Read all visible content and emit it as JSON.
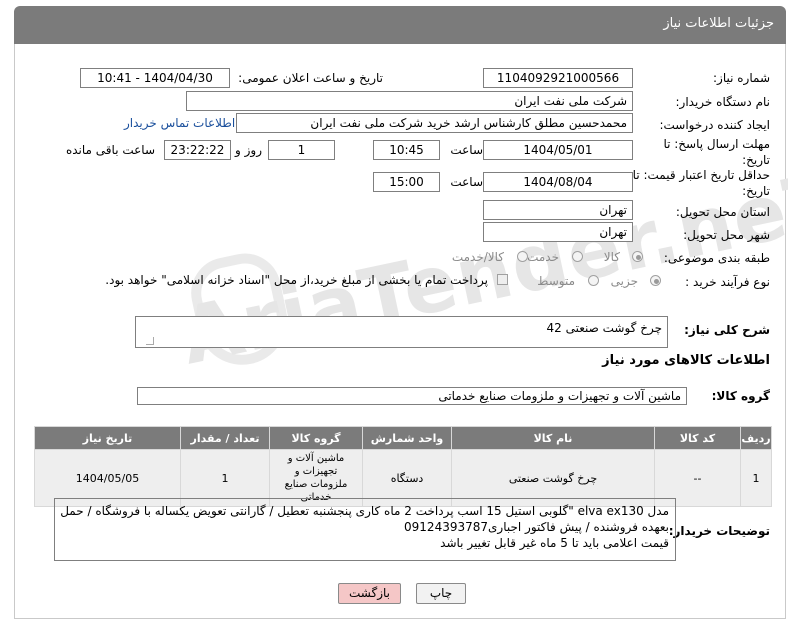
{
  "header": {
    "title": "جزئیات اطلاعات نیاز"
  },
  "fields": {
    "need_number_label": "شماره نیاز:",
    "need_number": "1104092921000566",
    "announce_label": "تاریخ و ساعت اعلان عمومی:",
    "announce_value": "1404/04/30 - 10:41",
    "buyer_org_label": "نام دستگاه خریدار:",
    "buyer_org": "شرکت ملی نفت ایران",
    "creator_label": "ایجاد کننده درخواست:",
    "creator": "محمدحسین مطلق کارشناس ارشد خرید شرکت ملی نفت ایران",
    "contact_link": "اطلاعات تماس خریدار",
    "deadline_label": "مهلت ارسال پاسخ: تا تاریخ:",
    "deadline_date": "1404/05/01",
    "time_label": "ساعت",
    "deadline_time": "10:45",
    "days_count": "1",
    "days_label": "روز و",
    "remaining_time": "23:22:22",
    "remaining_label": "ساعت باقی مانده",
    "price_validity_label": "حداقل تاریخ اعتبار قیمت: تا تاریخ:",
    "price_validity_date": "1404/08/04",
    "price_validity_time": "15:00",
    "province_label": "استان محل تحویل:",
    "province": "تهران",
    "city_label": "شهر محل تحویل:",
    "city": "تهران",
    "category_label": "طبقه بندی موضوعی:",
    "category_options": [
      "کالا",
      "خدمت",
      "کالا/خدمت"
    ],
    "process_label": "نوع فرآیند خرید :",
    "process_options": [
      "جزیی",
      "متوسط"
    ],
    "payment_note": "پرداخت تمام یا بخشی از مبلغ خرید،از محل \"اسناد خزانه اسلامی\" خواهد بود."
  },
  "summary": {
    "label": "شرح کلی نیاز:",
    "value": "چرخ گوشت صنعتی  42"
  },
  "goods_section": {
    "title": "اطلاعات کالاهای مورد نیاز",
    "group_label": "گروه کالا:",
    "group_value": "ماشین آلات و تجهیزات و ملزومات صنایع خدماتی"
  },
  "table": {
    "headers": [
      "ردیف",
      "کد کالا",
      "نام کالا",
      "واحد شمارش",
      "گروه کالا",
      "تعداد / مقدار",
      "تاریخ نیاز"
    ],
    "rows": [
      [
        "1",
        "--",
        "چرخ گوشت صنعتی",
        "دستگاه",
        "ماشین آلات و تجهیزات و ملزومات صنایع خدماتی",
        "1",
        "1404/05/05"
      ]
    ]
  },
  "buyer_notes": {
    "label": "توضیحات خریدار:",
    "lines": [
      "مدل elva ex130  \"گلوبی استیل  15 اسب پرداخت 2 ماه کاری پنجشنبه تعطیل / گارانتی تعویض یکساله با فروشگاه / حمل",
      "بعهده فروشنده / پیش فاکتور اجباری09124393787",
      "قیمت اعلامی باید تا 5 ماه غیر قابل تغییر باشد"
    ]
  },
  "buttons": {
    "print": "چاپ",
    "back": "بازگشت"
  },
  "watermark": "AriaTender.neT"
}
